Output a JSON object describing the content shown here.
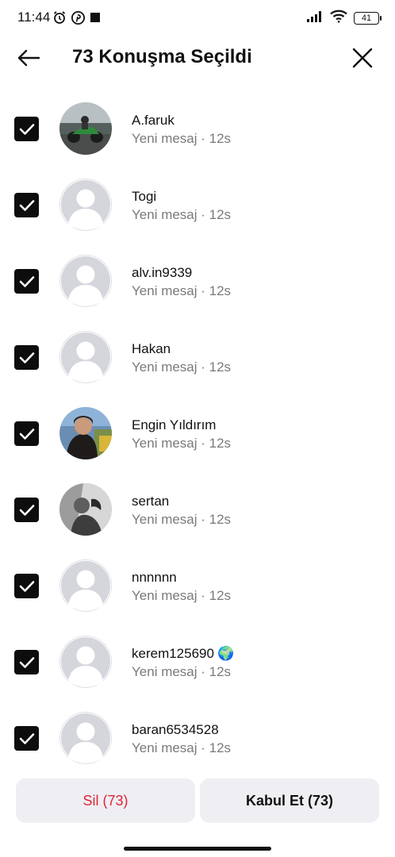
{
  "status_bar": {
    "time": "11:44",
    "battery": "41",
    "left_icons": [
      "alarm-icon",
      "pinterest-icon",
      "square-icon"
    ],
    "right_icons": [
      "signal-icon",
      "wifi-icon",
      "battery-icon"
    ]
  },
  "header": {
    "title": "73 Konuşma Seçildi",
    "back_icon": "back-arrow-icon",
    "close_icon": "close-icon"
  },
  "conversations": [
    {
      "name": "A.faruk",
      "subtitle": "Yeni mesaj · 12s",
      "checked": true,
      "avatar": "photo-motorcycle"
    },
    {
      "name": "Togi",
      "subtitle": "Yeni mesaj · 12s",
      "checked": true,
      "avatar": "default"
    },
    {
      "name": "alv.in9339",
      "subtitle": "Yeni mesaj · 12s",
      "checked": true,
      "avatar": "default"
    },
    {
      "name": "Hakan",
      "subtitle": "Yeni mesaj · 12s",
      "checked": true,
      "avatar": "default"
    },
    {
      "name": "Engin Yıldırım",
      "subtitle": "Yeni mesaj · 12s",
      "checked": true,
      "avatar": "photo-person-outdoor"
    },
    {
      "name": "sertan",
      "subtitle": "Yeni mesaj · 12s",
      "checked": true,
      "avatar": "photo-bw"
    },
    {
      "name": "nnnnnn",
      "subtitle": "Yeni mesaj · 12s",
      "checked": true,
      "avatar": "default"
    },
    {
      "name": "kerem125690",
      "name_emoji": "🌍",
      "subtitle": "Yeni mesaj · 12s",
      "checked": true,
      "avatar": "default"
    },
    {
      "name": "baran6534528",
      "subtitle": "Yeni mesaj · 12s",
      "checked": true,
      "avatar": "default"
    }
  ],
  "actions": {
    "delete_label": "Sil (73)",
    "accept_label": "Kabul Et (73)"
  },
  "colors": {
    "delete": "#e0243a",
    "button_bg": "#efeff3",
    "checkbox": "#0d0d0d",
    "subtitle": "#7a7a7a"
  }
}
